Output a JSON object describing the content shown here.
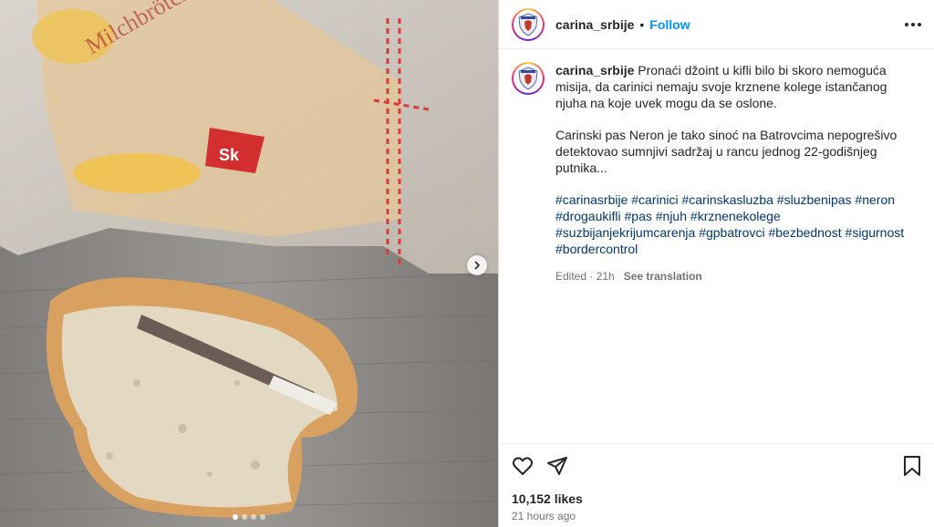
{
  "post": {
    "username": "carina_srbije",
    "follow_label": "Follow",
    "caption_intro": "Pronaći džoint u kifli bilo bi skoro nemoguća misija, da carinici nemaju svoje krznene kolege istančanog njuha na koje uvek mogu da se oslone.",
    "caption_p2": "Carinski pas Neron je tako sinoć na Batrovcima nepogrešivo detektovao sumnjivi sadržaj u rancu jednog 22-godišnjeg putnika...",
    "hashtags": [
      "#carinasrbije",
      "#carinici",
      "#carinskasluzba",
      "#sluzbenipas",
      "#neron",
      "#drogaukifli",
      "#pas",
      "#njuh",
      "#krznenekolege",
      "#suzbijanjekrijumcarenja",
      "#gpbatrovci",
      "#bezbednost",
      "#sigurnost",
      "#bordercontrol"
    ],
    "edited": "Edited · 21h",
    "see_translation": "See translation",
    "likes": "10,152 likes",
    "time_ago": "21 hours ago"
  },
  "media": {
    "slide_count": 4,
    "active_slide": 1
  },
  "icons": [
    "more-icon",
    "heart-icon",
    "share-icon",
    "bookmark-icon",
    "chevron-right-icon"
  ]
}
